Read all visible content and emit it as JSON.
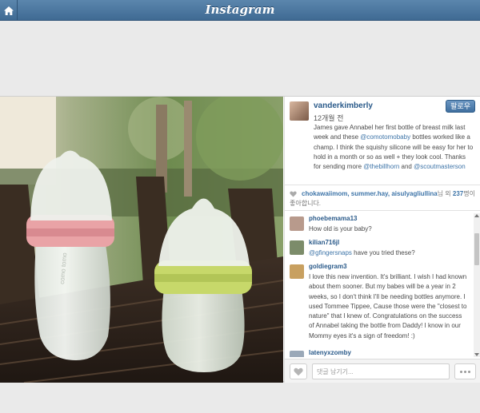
{
  "app": {
    "title": "Instagram"
  },
  "post": {
    "author": "vanderkimberly",
    "time": "12개월 전",
    "follow_label": "팔로우",
    "caption": [
      {
        "text": "James gave Annabel her first bottle of breast milk last week and these "
      },
      {
        "text": "@comotomobaby",
        "mention": true
      },
      {
        "text": " bottles worked like a champ. I think the squishy silicone will be easy for her to hold in a month or so as well + they look cool. Thanks for sending more "
      },
      {
        "text": "@thebillhorn",
        "mention": true
      },
      {
        "text": " and "
      },
      {
        "text": "@scoutmasterson",
        "mention": true
      }
    ],
    "likes": {
      "users": "chokawaiimom, summer.hay, aisulyagliullina",
      "suffix_prefix": "님 외 ",
      "count": "237",
      "suffix_end": "명이 좋아합니다."
    }
  },
  "comments": [
    {
      "user": "phoebemama13",
      "text": "How old is your baby?",
      "avatar_color": "#b89a8c"
    },
    {
      "user": "kilian716jl",
      "text": "@gfingersnaps have you tried these?",
      "avatar_color": "#7c8c6a"
    },
    {
      "user": "goldiegram3",
      "text": "I love this new invention. It's brilliant. I wish I had known about them sooner. But my babes will be a year in 2 weeks, so I don't think I'll be needing bottles anymore. I used Tommee Tippee, Cause those were the \"closest to nature\" that I knew of. Congratulations on the success of Annabel taking the bottle from Daddy! I know in our Mommy eyes it's a sign of freedom! :)",
      "avatar_color": "#c8a060"
    },
    {
      "user": "latenyxzomby",
      "text": "",
      "avatar_color": "#9aa8b8"
    }
  ],
  "comment_box": {
    "placeholder": "댓글 남기기..."
  },
  "icons": {
    "home": "home-icon",
    "like": "heart-icon",
    "more": "more-dots-icon"
  },
  "colors": {
    "topbar": "#4a7aa6",
    "link": "#3d74a8",
    "follow_button": "#4f7fb0"
  }
}
